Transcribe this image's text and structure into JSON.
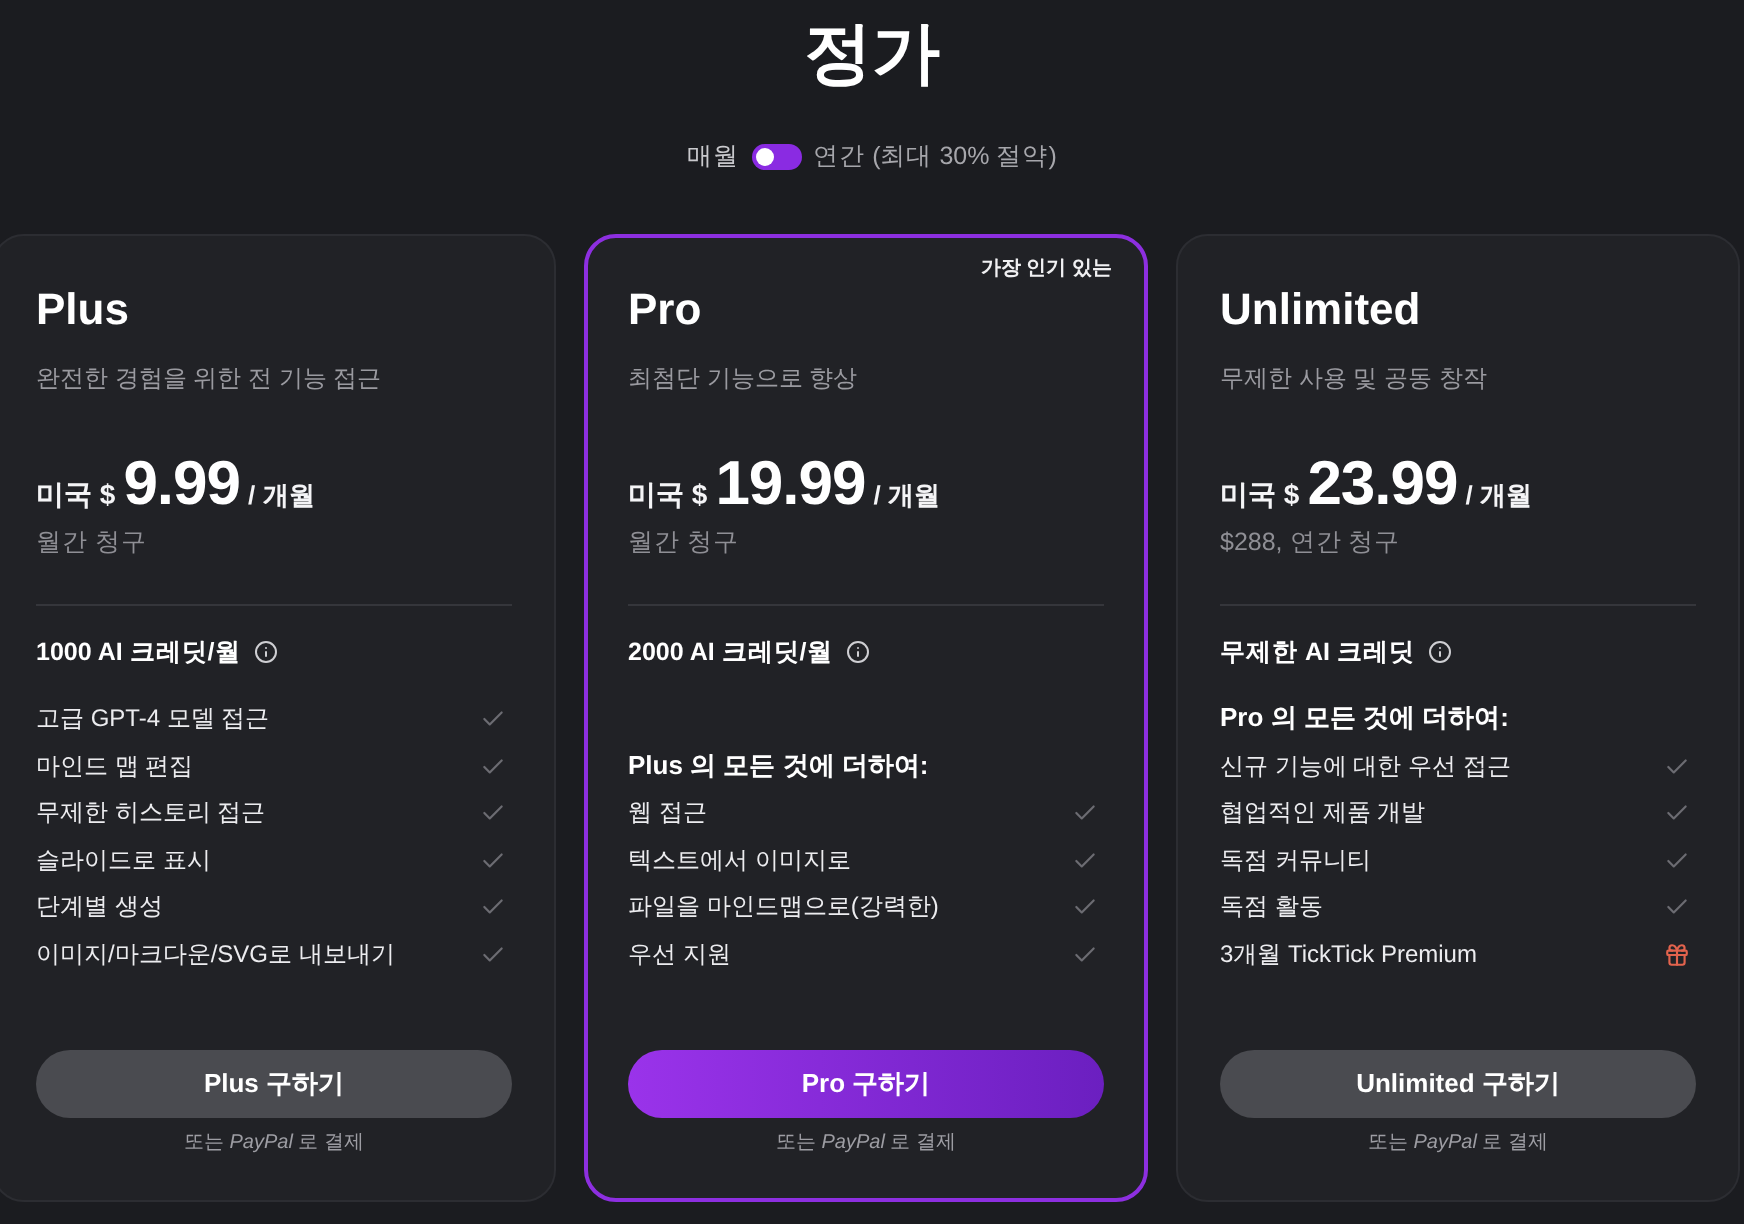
{
  "title": "정가",
  "billing_toggle": {
    "left_label": "매월",
    "annual": false,
    "right_label": "연간 (최대 30% 절약)"
  },
  "plans": [
    {
      "name": "Plus",
      "highlighted": false,
      "description": "완전한 경험을 위한 전 기능 접근",
      "currency": "미국 $",
      "price": "9.99",
      "period": "/ 개월",
      "billing": "월간 청구",
      "credits": "1000 AI 크레딧/월",
      "features": [
        {
          "text": "고급 GPT-4 모델 접근",
          "kind": "check"
        },
        {
          "text": "마인드 맵 편집",
          "kind": "check"
        },
        {
          "text": "무제한 히스토리 접근",
          "kind": "check"
        },
        {
          "text": "슬라이드로 표시",
          "kind": "check"
        },
        {
          "text": "단계별 생성",
          "kind": "check"
        },
        {
          "text": "이미지/마크다운/SVG로 내보내기",
          "kind": "check"
        }
      ],
      "button": "Plus 구하기",
      "paypal_note": "또는 *PayPal* 로 결제"
    },
    {
      "name": "Pro",
      "highlighted": true,
      "badge": "가장 인기 있는",
      "description": "최첨단 기능으로 향상",
      "currency": "미국 $",
      "price": "19.99",
      "period": "/ 개월",
      "billing": "월간 청구",
      "credits": "2000 AI 크레딧/월",
      "features_header": "Plus 의 모든 것에 더하여:",
      "features": [
        {
          "text": "웹 접근",
          "kind": "check"
        },
        {
          "text": "텍스트에서 이미지로",
          "kind": "check"
        },
        {
          "text": "파일을 마인드맵으로(강력한)",
          "kind": "check"
        },
        {
          "text": "우선 지원",
          "kind": "check"
        }
      ],
      "button": "Pro 구하기",
      "paypal_note": "또는 *PayPal* 로 결제"
    },
    {
      "name": "Unlimited",
      "highlighted": false,
      "description": "무제한 사용 및 공동 창작",
      "currency": "미국 $",
      "price": "23.99",
      "period": "/ 개월",
      "billing": "$288, 연간 청구",
      "credits": "무제한 AI 크레딧",
      "features_header": "Pro 의 모든 것에 더하여:",
      "features": [
        {
          "text": "신규 기능에 대한 우선 접근",
          "kind": "check"
        },
        {
          "text": "협업적인 제품 개발",
          "kind": "check"
        },
        {
          "text": "독점 커뮤니티",
          "kind": "check"
        },
        {
          "text": "독점 활동",
          "kind": "check"
        },
        {
          "text": "3개월 TickTick Premium",
          "kind": "gift"
        }
      ],
      "button": "Unlimited 구하기",
      "paypal_note": "또는 *PayPal* 로 결제"
    }
  ]
}
